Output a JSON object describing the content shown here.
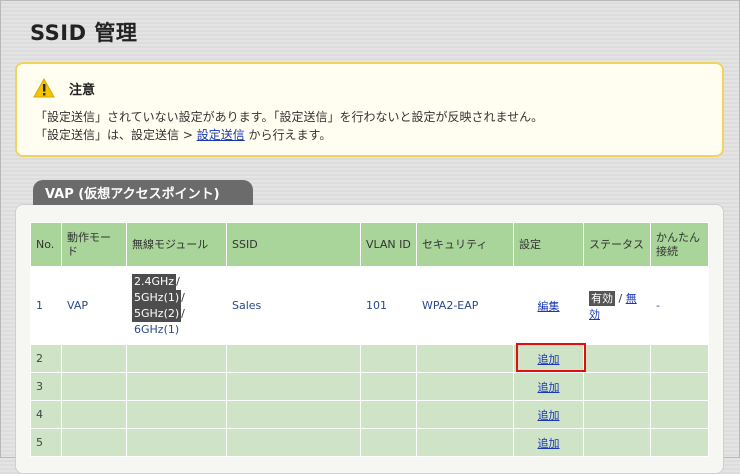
{
  "page": {
    "title": "SSID 管理"
  },
  "notice": {
    "title": "注意",
    "line1": "「設定送信」されていない設定があります。「設定送信」を行わないと設定が反映されません。",
    "line2_prefix": "「設定送信」は、設定送信 > ",
    "line2_link": "設定送信",
    "line2_suffix": " から行えます。"
  },
  "section": {
    "tab_label": "VAP (仮想アクセスポイント)"
  },
  "table": {
    "headers": [
      "No.",
      "動作モード",
      "無線モジュール",
      "SSID",
      "VLAN ID",
      "セキュリティ",
      "設定",
      "ステータス",
      "かんたん接続"
    ],
    "rows": [
      {
        "no": "1",
        "mode": "VAP",
        "modules": [
          "2.4GHz",
          "5GHz(1)",
          "5GHz(2)",
          "6GHz(1)"
        ],
        "module_sep": "/",
        "ssid": "Sales",
        "vlan_id": "101",
        "security": "WPA2-EAP",
        "setting": "編集",
        "status_enabled": "有効",
        "status_sep": "/",
        "status_disabled": "無効",
        "easy_connect": "-"
      },
      {
        "no": "2",
        "setting": "追加"
      },
      {
        "no": "3",
        "setting": "追加"
      },
      {
        "no": "4",
        "setting": "追加"
      },
      {
        "no": "5",
        "setting": "追加"
      }
    ]
  },
  "colors": {
    "accent_red": "#e01010",
    "header_green": "#a9d49a",
    "row_green": "#cfe3c7",
    "link": "#1a37b5"
  }
}
